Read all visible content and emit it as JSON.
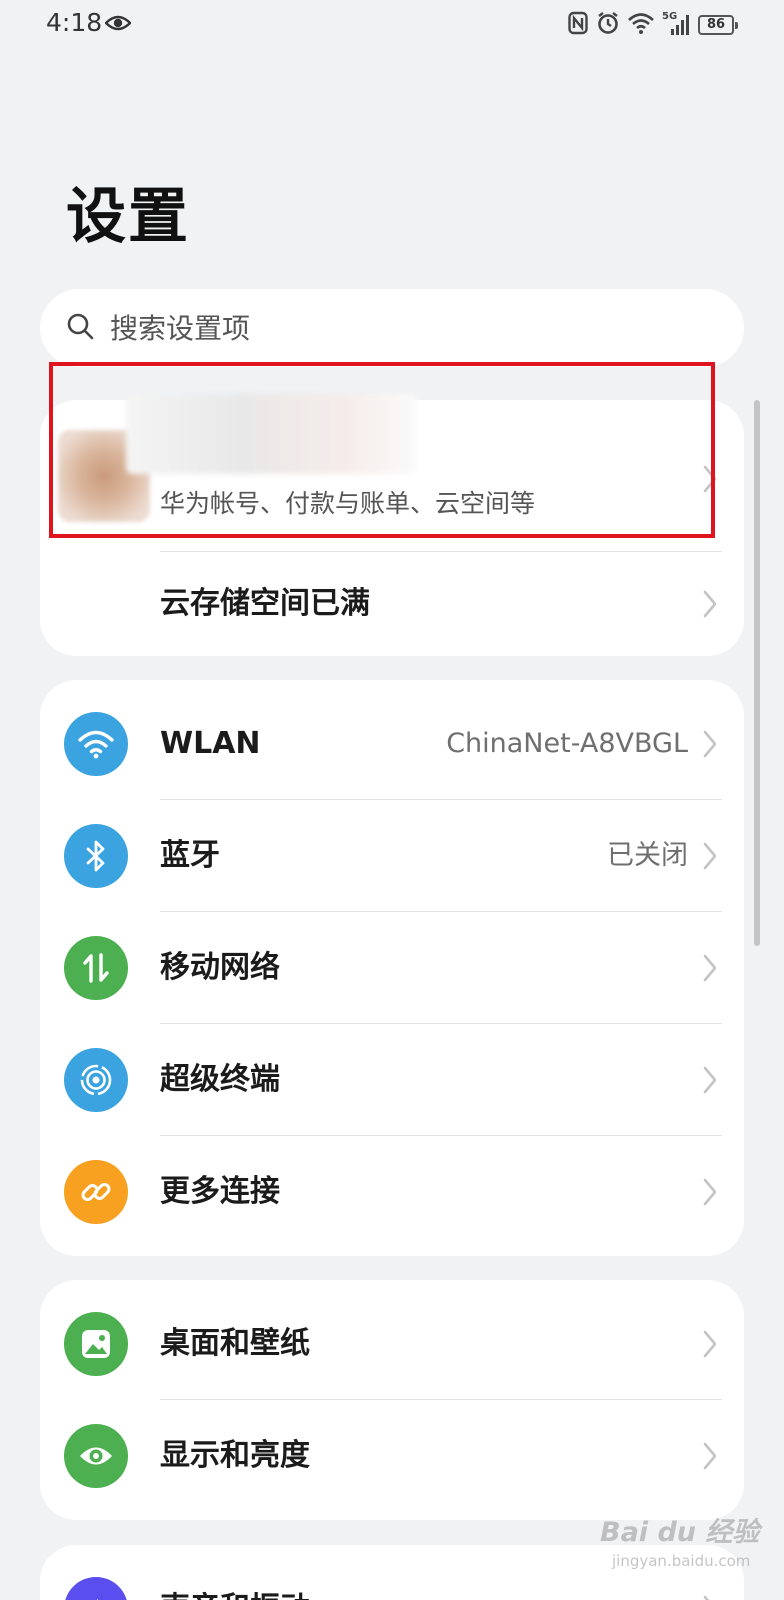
{
  "status_bar": {
    "time": "4:18",
    "network": "5G",
    "battery": "86"
  },
  "page": {
    "title": "设置"
  },
  "search": {
    "placeholder": "搜索设置项"
  },
  "account": {
    "subtitle": "华为帐号、付款与账单、云空间等",
    "cloud_storage_label": "云存储空间已满"
  },
  "connectivity": [
    {
      "label": "WLAN",
      "value": "ChinaNet-A8VBGL",
      "icon": "wifi-icon",
      "color": "#3ba4e0"
    },
    {
      "label": "蓝牙",
      "value": "已关闭",
      "icon": "bluetooth-icon",
      "color": "#3ba4e0"
    },
    {
      "label": "移动网络",
      "value": "",
      "icon": "mobile-data-icon",
      "color": "#4caf50"
    },
    {
      "label": "超级终端",
      "value": "",
      "icon": "super-device-icon",
      "color": "#3ba4e0"
    },
    {
      "label": "更多连接",
      "value": "",
      "icon": "link-icon",
      "color": "#f8a020"
    }
  ],
  "display": [
    {
      "label": "桌面和壁纸",
      "icon": "wallpaper-icon",
      "color": "#4caf50"
    },
    {
      "label": "显示和亮度",
      "icon": "eye-icon",
      "color": "#4caf50"
    }
  ],
  "partial": {
    "label": "声音和振动",
    "icon": "sound-icon",
    "color": "#5b4ef0"
  },
  "watermark": {
    "text": "Bai du 经验",
    "sub": "jingyan.baidu.com"
  }
}
